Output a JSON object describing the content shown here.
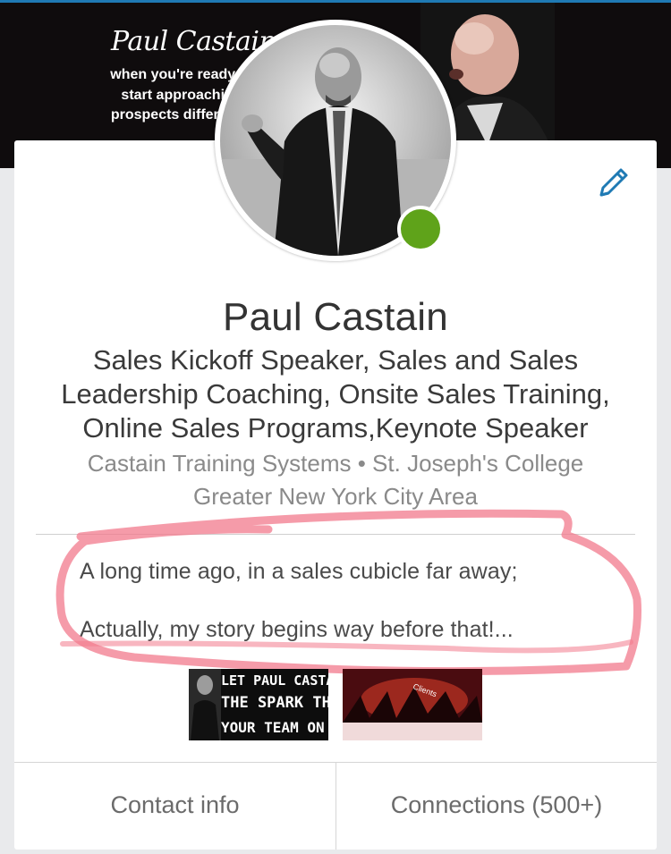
{
  "banner": {
    "title": "Paul Castain",
    "tagline": "when you're ready to start approaching prospects differently"
  },
  "profile": {
    "name": "Paul Castain",
    "headline_line1": "Sales Kickoff Speaker, Sales and Sales",
    "headline_line2": "Leadership Coaching, Onsite Sales Training,",
    "headline_line3": "Online Sales Programs,Keynote Speaker",
    "companies": "Castain Training Systems • St. Joseph's College",
    "location": "Greater New York City Area",
    "status": "online",
    "status_color": "#5fa31a"
  },
  "summary": {
    "line1": "A long time ago, in a sales cubicle far away;",
    "line2": "Actually, my story begins way before that!..."
  },
  "media": [
    {
      "line1": "LET PAUL CASTA",
      "line2": "THE SPARK THA",
      "line3": "YOUR TEAM ON F"
    },
    {
      "label": "Clients"
    }
  ],
  "actions": {
    "contact": "Contact info",
    "connections": "Connections (500+)"
  },
  "icons": {
    "edit": "pencil-icon"
  },
  "colors": {
    "accent": "#1f7ab4",
    "highlight_ink": "#f27a8c"
  }
}
